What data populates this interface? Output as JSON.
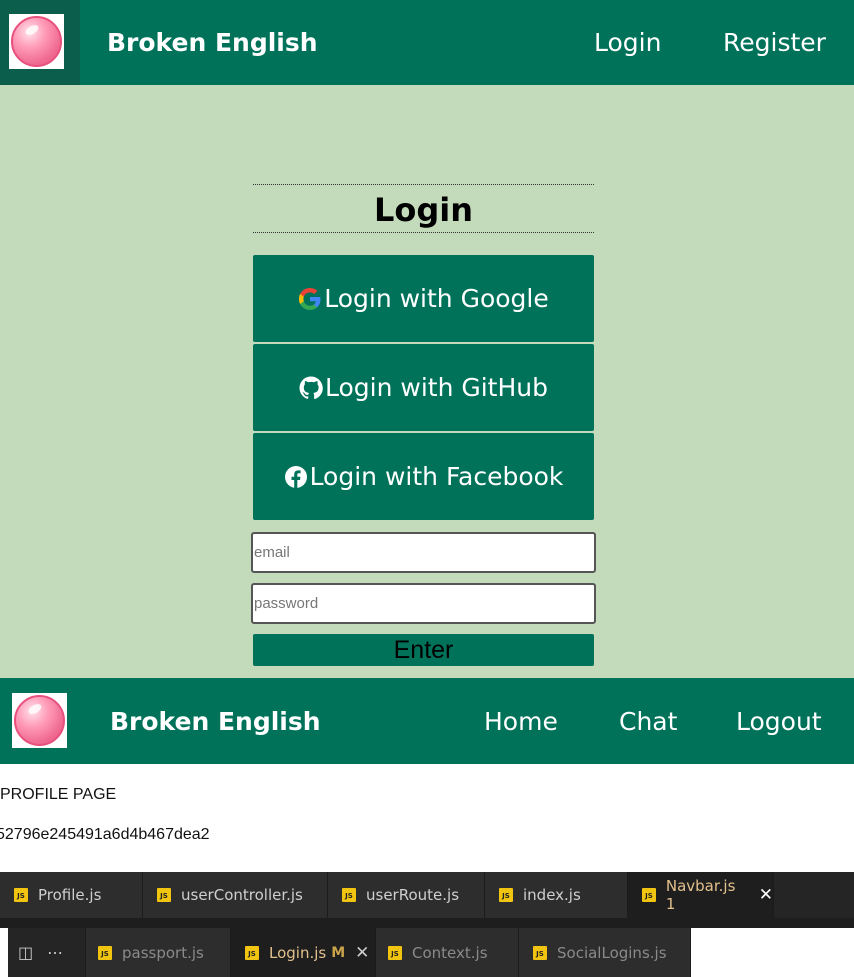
{
  "top_nav": {
    "brand": "Broken English",
    "links": [
      "Login",
      "Register"
    ]
  },
  "login": {
    "title": "Login",
    "google_label": "Login with Google",
    "github_label": "Login with GitHub",
    "facebook_label": "Login with Facebook",
    "email_placeholder": "email",
    "password_placeholder": "password",
    "enter_label": "Enter"
  },
  "bottom_nav": {
    "brand": "Broken English",
    "links": [
      "Home",
      "Chat",
      "Logout"
    ]
  },
  "profile": {
    "heading": "PROFILE PAGE",
    "user_id": "52796e245491a6d4b467dea2"
  },
  "editor_tabs_row1": [
    {
      "label": "Profile.js",
      "icon": "js-file-icon"
    },
    {
      "label": "userController.js",
      "icon": "js-file-icon"
    },
    {
      "label": "userRoute.js",
      "icon": "js-file-icon"
    },
    {
      "label": "index.js",
      "icon": "js-file-icon"
    },
    {
      "label": "Navbar.js 1",
      "icon": "js-file-icon",
      "active": true
    }
  ],
  "editor_tabs_row2": [
    {
      "label": "passport.js",
      "icon": "js-file-icon"
    },
    {
      "label": "Login.js",
      "modified": "M",
      "icon": "js-file-icon",
      "active": true
    },
    {
      "label": "Context.js",
      "icon": "js-file-icon"
    },
    {
      "label": "SocialLogins.js",
      "icon": "js-file-icon"
    }
  ],
  "colors": {
    "nav_bg": "#00725a",
    "page_bg": "#c3dbba",
    "tab_bg": "#2d2d2d"
  }
}
